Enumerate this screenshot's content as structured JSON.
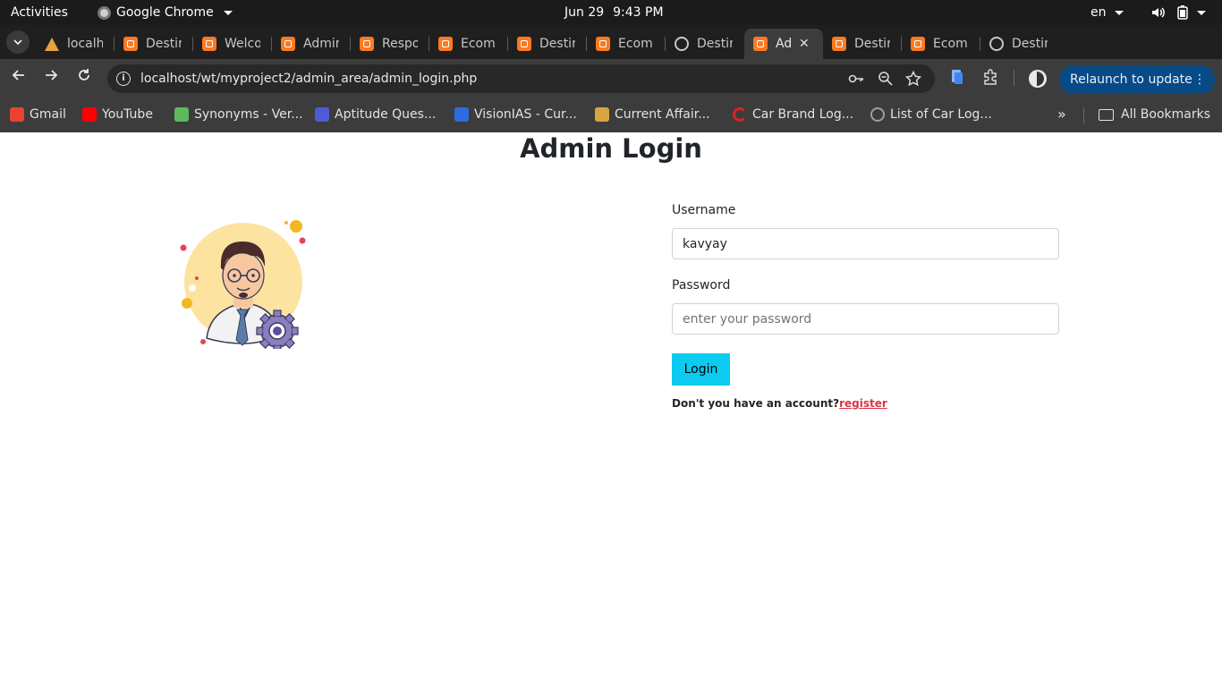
{
  "system_bar": {
    "activities": "Activities",
    "app_name": "Google Chrome",
    "date": "Jun 29",
    "time": "9:43 PM",
    "language": "en"
  },
  "tabs": [
    {
      "title": "localh",
      "icon": "localhost-icon",
      "active": false
    },
    {
      "title": "Destir",
      "icon": "xampp-icon",
      "active": false
    },
    {
      "title": "Welco",
      "icon": "xampp-icon",
      "active": false
    },
    {
      "title": "Admir",
      "icon": "xampp-icon",
      "active": false
    },
    {
      "title": "Respo",
      "icon": "xampp-icon",
      "active": false
    },
    {
      "title": "Ecomr",
      "icon": "xampp-icon",
      "active": false
    },
    {
      "title": "Destir",
      "icon": "xampp-icon",
      "active": false
    },
    {
      "title": "Ecomr",
      "icon": "xampp-icon",
      "active": false
    },
    {
      "title": "Destir",
      "icon": "globe-icon",
      "active": false
    },
    {
      "title": "Ad",
      "icon": "xampp-icon",
      "active": true
    },
    {
      "title": "Destir",
      "icon": "xampp-icon",
      "active": false
    },
    {
      "title": "Ecomr",
      "icon": "xampp-icon",
      "active": false
    },
    {
      "title": "Destir",
      "icon": "globe-icon",
      "active": false
    }
  ],
  "toolbar": {
    "url": "localhost/wt/myproject2/admin_area/admin_login.php",
    "relaunch_label": "Relaunch to update"
  },
  "bookmarks": [
    {
      "label": "Gmail",
      "icon": "gmail-icon",
      "color": "#ea4335"
    },
    {
      "label": "YouTube",
      "icon": "youtube-icon",
      "color": "#ff0000"
    },
    {
      "label": "Synonyms - Ver...",
      "icon": "synonyms-icon",
      "color": "#5fb85f"
    },
    {
      "label": "Aptitude Ques...",
      "icon": "aptitude-icon",
      "color": "#4f5bd5"
    },
    {
      "label": "VisionIAS - Cur...",
      "icon": "visionias-icon",
      "color": "#2d6cdf"
    },
    {
      "label": "Current Affair...",
      "icon": "current-affairs-icon",
      "color": "#d9a441"
    },
    {
      "label": "Car Brand Log...",
      "icon": "car-brand-icon",
      "color": "#e02020"
    },
    {
      "label": "List of Car Log...",
      "icon": "globe-icon",
      "color": "#9e9e9e"
    }
  ],
  "bookmarks_all": "All Bookmarks",
  "login": {
    "title": "Admin Login",
    "username_label": "Username",
    "username_value": "kavyay",
    "password_label": "Password",
    "password_placeholder": "enter your password",
    "login_button": "Login",
    "register_prompt": "Don't you have an account?",
    "register_link": "register"
  },
  "colors": {
    "login_button": "#0dcaf0",
    "register_link": "#dc3545",
    "relaunch_button": "#074a86"
  }
}
